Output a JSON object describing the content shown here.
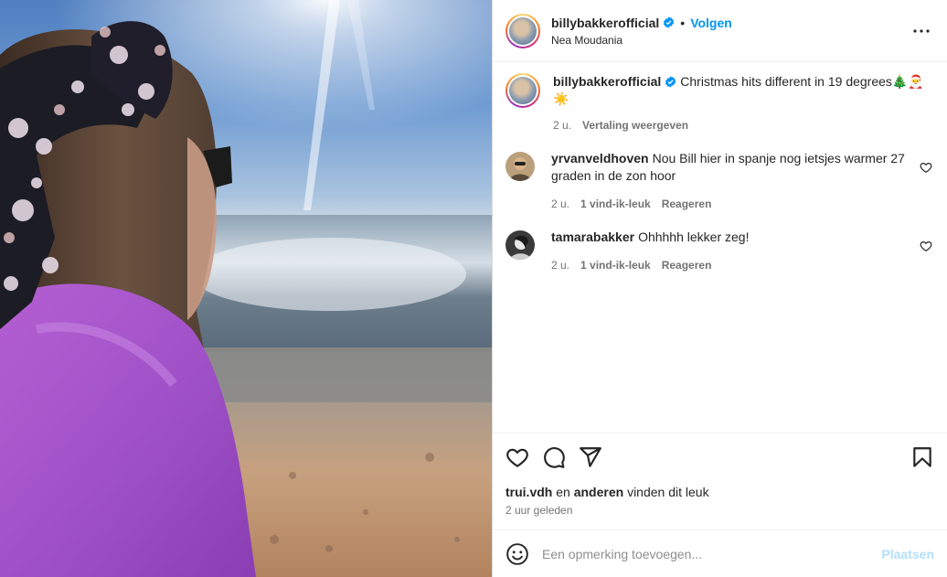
{
  "post": {
    "username": "billybakkerofficial",
    "dot": "•",
    "follow_label": "Volgen",
    "location": "Nea Moudania",
    "more_icon": "more-horizontal-icon"
  },
  "caption": {
    "username": "billybakkerofficial",
    "text": "Christmas hits different in 19 degrees🎄🎅☀️",
    "time": "2 u.",
    "translate_label": "Vertaling weergeven"
  },
  "comments": [
    {
      "username": "yrvanveldhoven",
      "text": "Nou Bill hier in spanje nog ietsjes warmer 27 graden in de zon hoor",
      "time": "2 u.",
      "likes": "1 vind-ik-leuk",
      "reply_label": "Reageren"
    },
    {
      "username": "tamarabakker",
      "text": "Ohhhhh lekker zeg!",
      "time": "2 u.",
      "likes": "1 vind-ik-leuk",
      "reply_label": "Reageren"
    }
  ],
  "actions": {
    "icons": [
      "heart-icon",
      "comment-icon",
      "share-icon",
      "bookmark-icon"
    ]
  },
  "likes_line": {
    "user": "trui.vdh",
    "and": "en",
    "others": "anderen",
    "rest": "vinden dit leuk"
  },
  "posted_ago": "2 uur geleden",
  "add_comment": {
    "placeholder": "Een opmerking toevoegen...",
    "post_label": "Plaatsen"
  },
  "colors": {
    "accent": "#0095f6",
    "post_disabled": "#b2dffc",
    "secondary_text": "#737373"
  }
}
